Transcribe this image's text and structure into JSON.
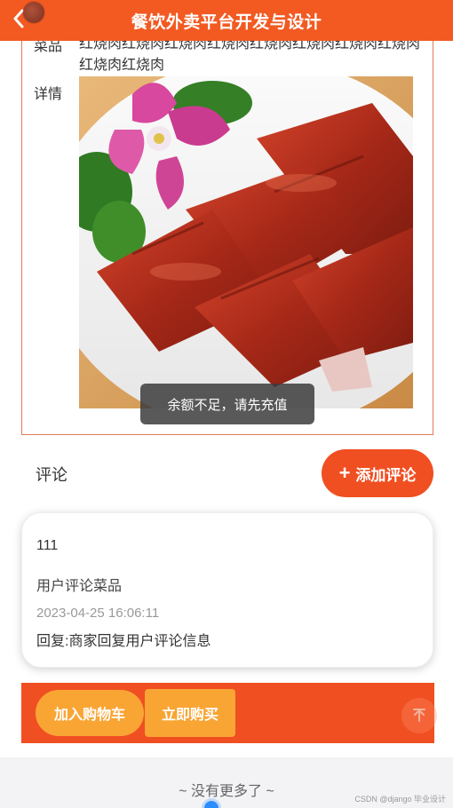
{
  "header": {
    "title": "餐饮外卖平台开发与设计",
    "back_icon": "chevron-left-icon"
  },
  "detail": {
    "name_label": "菜品",
    "name_value": "红烧肉红烧肉红烧肉红烧肉红烧肉红烧肉红烧肉红烧肉红烧肉红烧肉",
    "detail_label": "详情"
  },
  "toast": {
    "text": "余额不足，请先充值"
  },
  "comments": {
    "label": "评论",
    "add_button": "添加评论",
    "add_icon": "plus-icon",
    "items": [
      {
        "user": "111",
        "content": "用户评论菜品",
        "time": "2023-04-25 16:06:11",
        "reply": "回复:商家回复用户评论信息"
      }
    ]
  },
  "actions": {
    "cart_button": "加入购物车",
    "buy_button": "立即购买",
    "top_icon": "arrow-up-icon"
  },
  "footer": {
    "no_more": "~ 没有更多了 ~",
    "watermark": "CSDN @django 毕业设计"
  },
  "colors": {
    "brand": "#f25a22",
    "button": "#f04f22",
    "secondary_button": "#f9a534"
  }
}
